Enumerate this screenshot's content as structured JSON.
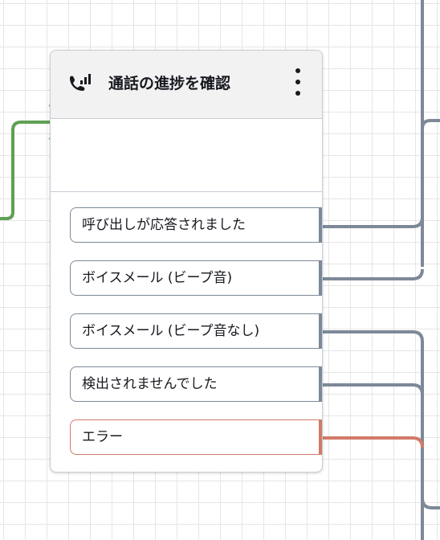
{
  "block": {
    "title": "通話の進捗を確認",
    "icon": "call-progress-icon",
    "menu_icon": "more-vertical-icon",
    "branches": [
      {
        "label": "呼び出しが応答されました",
        "status": "normal"
      },
      {
        "label": "ボイスメール (ビープ音)",
        "status": "normal"
      },
      {
        "label": "ボイスメール (ビープ音なし)",
        "status": "normal"
      },
      {
        "label": "検出されませんでした",
        "status": "normal"
      },
      {
        "label": "エラー",
        "status": "error"
      }
    ]
  },
  "colors": {
    "incoming_connector": "#5fa052",
    "connector": "#7d8998",
    "error": "#d27a68",
    "header_bg": "#f2f2f2"
  }
}
